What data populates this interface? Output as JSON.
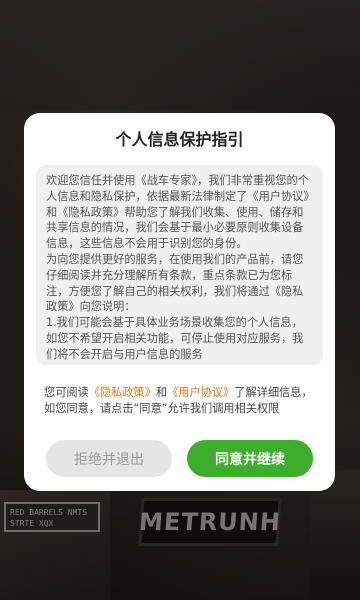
{
  "background": {
    "tag_text": "RED BARRELS NMTS  STRTE XQX",
    "logo_text": "METRUNH"
  },
  "dialog": {
    "title": "个人信息保护指引",
    "body": "欢迎您信任并使用《战车专家》，我们非常重视您的个人信息和隐私保护，依据最新法律制定了《用户协议》和《隐私政策》帮助您了解我们收集、使用、储存和共享信息的情况，我们会基于最小必要原则收集设备信息，这些信息不会用于识别您的身份。\n为向您提供更好的服务，在使用我们的产品前，请您仔细阅读并充分理解所有条款，重点条款已为您标注，方便您了解自己的相关权利，我们将通过《隐私政策》向您说明：\n1.我们可能会基于具体业务场景收集您的个人信息，如您不希望开启相关功能，可停止使用对应服务，我们将不会开启与用户信息的服务",
    "summary_prefix": "您可阅读",
    "privacy_link": "《隐私政策》",
    "summary_and": "和",
    "agreement_link": "《用户协议》",
    "summary_suffix": "了解详细信息，如您同意，请点击“同意”允许我们调用相关权限",
    "reject_label": "拒绝并退出",
    "agree_label": "同意并继续"
  },
  "colors": {
    "accent_link": "#e07b1b",
    "agree_button": "#3dae2b",
    "reject_button": "#e5e5e5"
  }
}
